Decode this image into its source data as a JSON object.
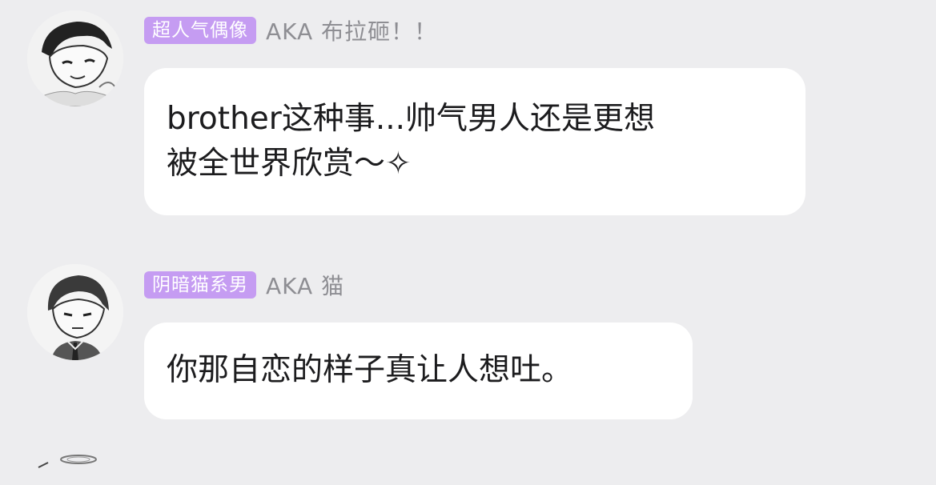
{
  "messages": [
    {
      "badge": "超人气偶像",
      "nickname": "AKA 布拉砸！！",
      "text_line1": "brother这种事...帅气男人还是更想",
      "text_line2": "被全世界欣赏～✧"
    },
    {
      "badge": "阴暗猫系男",
      "nickname": "AKA 猫",
      "text_line1": "你那自恋的样子真让人想吐。"
    }
  ],
  "colors": {
    "background": "#ededef",
    "badge": "#c59cf2",
    "nickname": "#8e8e93",
    "bubble": "#ffffff"
  }
}
